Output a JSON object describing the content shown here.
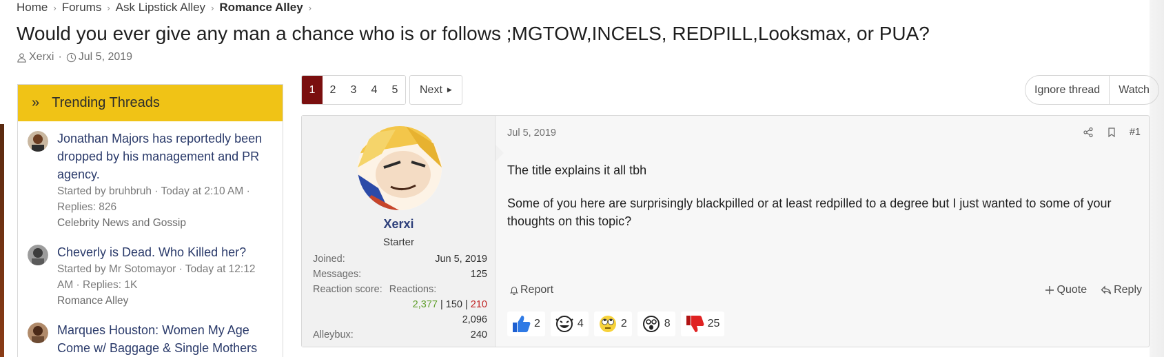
{
  "breadcrumb": [
    "Home",
    "Forums",
    "Ask Lipstick Alley",
    "Romance Alley"
  ],
  "thread": {
    "title": "Would you ever give any man a chance who is or follows ;MGTOW,INCELS, REDPILL,Looksmax, or PUA?",
    "author": "Xerxi",
    "date": "Jul 5, 2019"
  },
  "sidebar": {
    "title": "Trending Threads",
    "items": [
      {
        "title": "Jonathan Majors has reportedly been dropped by his management and PR agency.",
        "meta": "Started by bruhbruh · Today at 2:10 AM · Replies: 826",
        "forum": "Celebrity News and Gossip"
      },
      {
        "title": "Cheverly is Dead. Who Killed her?",
        "meta": "Started by Mr Sotomayor · Today at 12:12 AM · Replies: 1K",
        "forum": "Romance Alley"
      },
      {
        "title": "Marques Houston: Women My Age Come w/ Baggage & Single Mothers",
        "meta": "",
        "forum": ""
      }
    ]
  },
  "pager": {
    "pages": [
      "1",
      "2",
      "3",
      "4",
      "5"
    ],
    "current": "1",
    "next": "Next"
  },
  "thread_actions": {
    "ignore": "Ignore thread",
    "watch": "Watch"
  },
  "post": {
    "date": "Jul 5, 2019",
    "number": "#1",
    "body": [
      "The title explains it all tbh",
      "Some of you here are surprisingly blackpilled or at least redpilled to a degree but I just wanted to some of your thoughts on this topic?"
    ],
    "report": "Report",
    "quote": "Quote",
    "reply": "Reply"
  },
  "user": {
    "name": "Xerxi",
    "title": "Starter",
    "joined_label": "Joined:",
    "joined": "Jun 5, 2019",
    "messages_label": "Messages:",
    "messages": "125",
    "reaction_score_label": "Reaction score:",
    "reactions_label": "Reactions:",
    "reactions_pos": "2,377",
    "reactions_sep1": " | ",
    "reactions_neu": "150",
    "reactions_sep2": " | ",
    "reactions_neg": "210",
    "reaction_total": "2,096",
    "alleybux_label": "Alleybux:",
    "alleybux": "240"
  },
  "reactions": [
    {
      "icon": "thumbs-up-icon",
      "count": "2"
    },
    {
      "icon": "laughing-icon",
      "count": "4"
    },
    {
      "icon": "eye-roll-icon",
      "count": "2"
    },
    {
      "icon": "shocked-icon",
      "count": "8"
    },
    {
      "icon": "thumbs-down-icon",
      "count": "25"
    }
  ],
  "colors": {
    "accent": "#f0c316",
    "active_page": "#7a0f0f",
    "link": "#2a3a6a",
    "positive": "#5f9e2a",
    "negative": "#c02222"
  }
}
